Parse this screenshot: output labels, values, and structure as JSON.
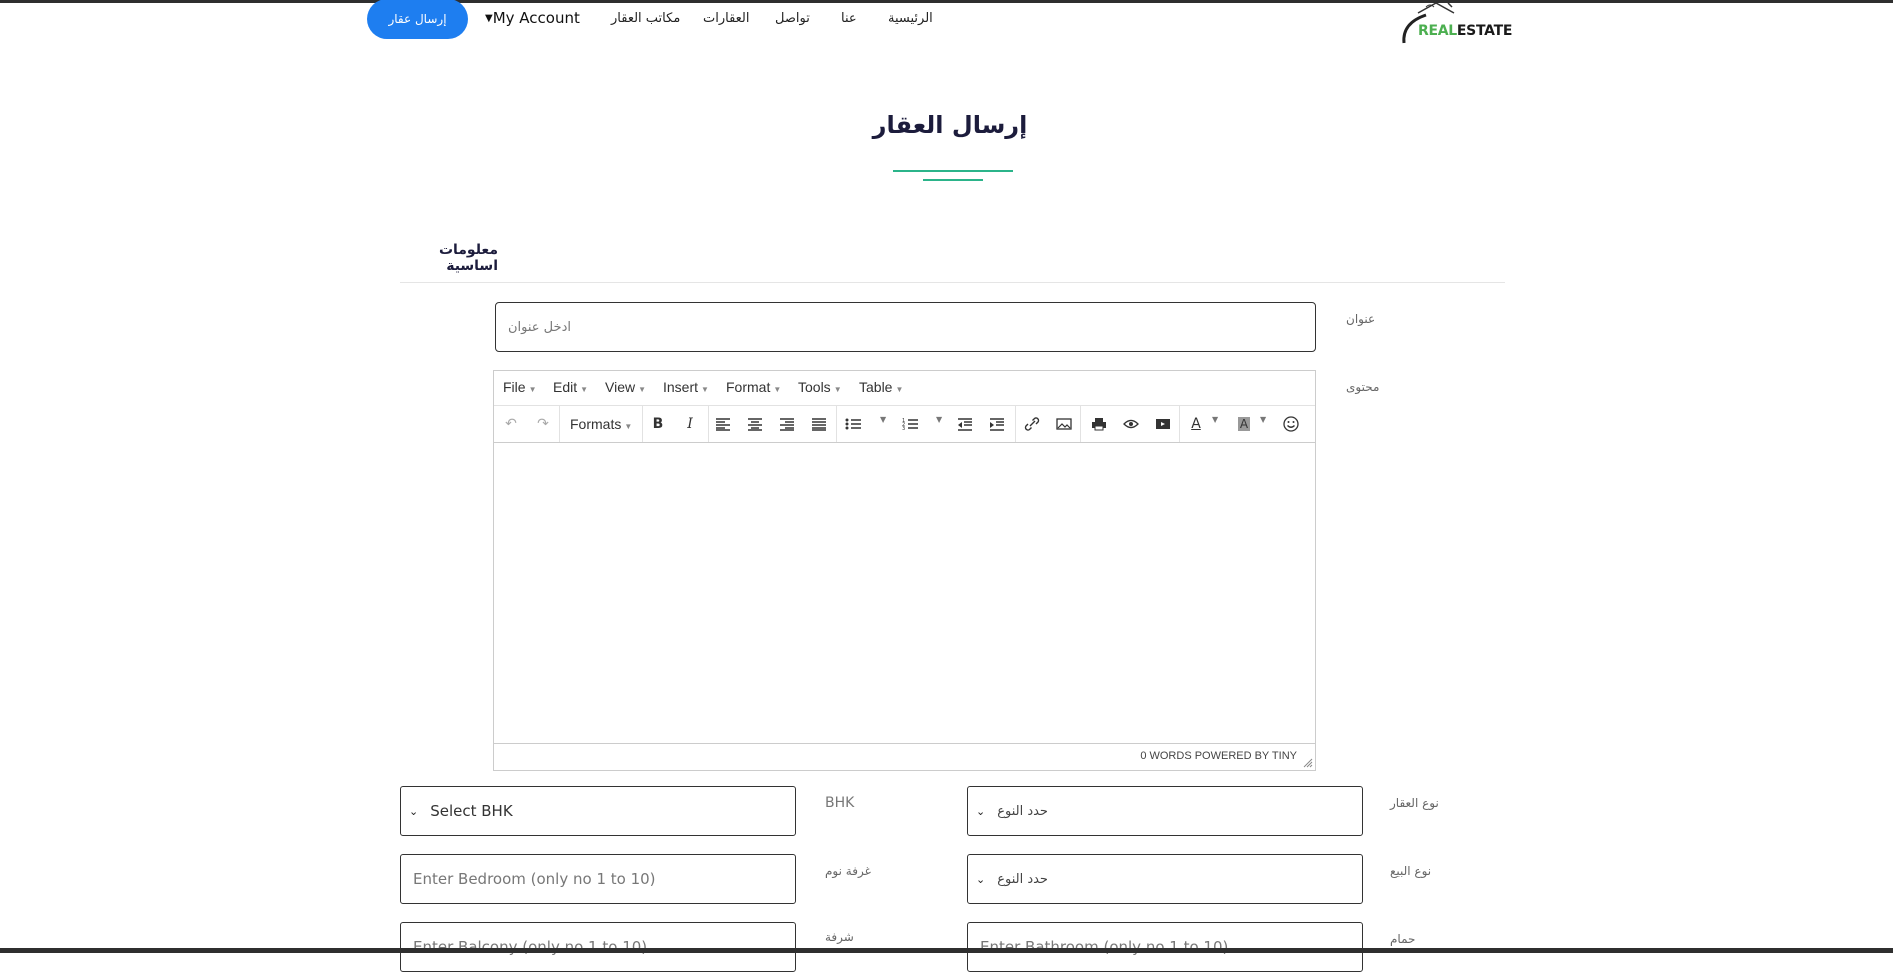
{
  "header": {
    "logo_text_a": "REAL",
    "logo_text_b": "ESTATE",
    "nav": [
      "الرئيسية",
      "عنا",
      "تواصل",
      "العقارات",
      "مكاتب العقار"
    ],
    "account_label": "My Account",
    "submit_label": "إرسال عقار"
  },
  "page": {
    "title": "إرسال العقار",
    "section_title": "معلومات اساسية"
  },
  "form": {
    "title_label": "عنوان",
    "title_placeholder": "ادخل عنوان",
    "content_label": "محتوى",
    "property_type_label": "نوع العقار",
    "property_type_value": "حدد النوع",
    "bhk_label": "BHK",
    "bhk_value": "Select BHK",
    "sale_type_label": "نوع البيع",
    "sale_type_value": "حدد النوع",
    "bedroom_label": "غرفة نوم",
    "bedroom_placeholder": "Enter Bedroom  (only no 1 to 10)",
    "bathroom_label": "حمام",
    "bathroom_placeholder": "Enter Bathroom (only no 1 to 10)",
    "balcony_label": "شرفة",
    "balcony_placeholder": "Enter Balcony  (only no 1 to 10)"
  },
  "editor": {
    "menus": [
      "File",
      "Edit",
      "View",
      "Insert",
      "Format",
      "Tools",
      "Table"
    ],
    "formats_label": "Formats",
    "status": "0 WORDS POWERED BY TINY"
  }
}
